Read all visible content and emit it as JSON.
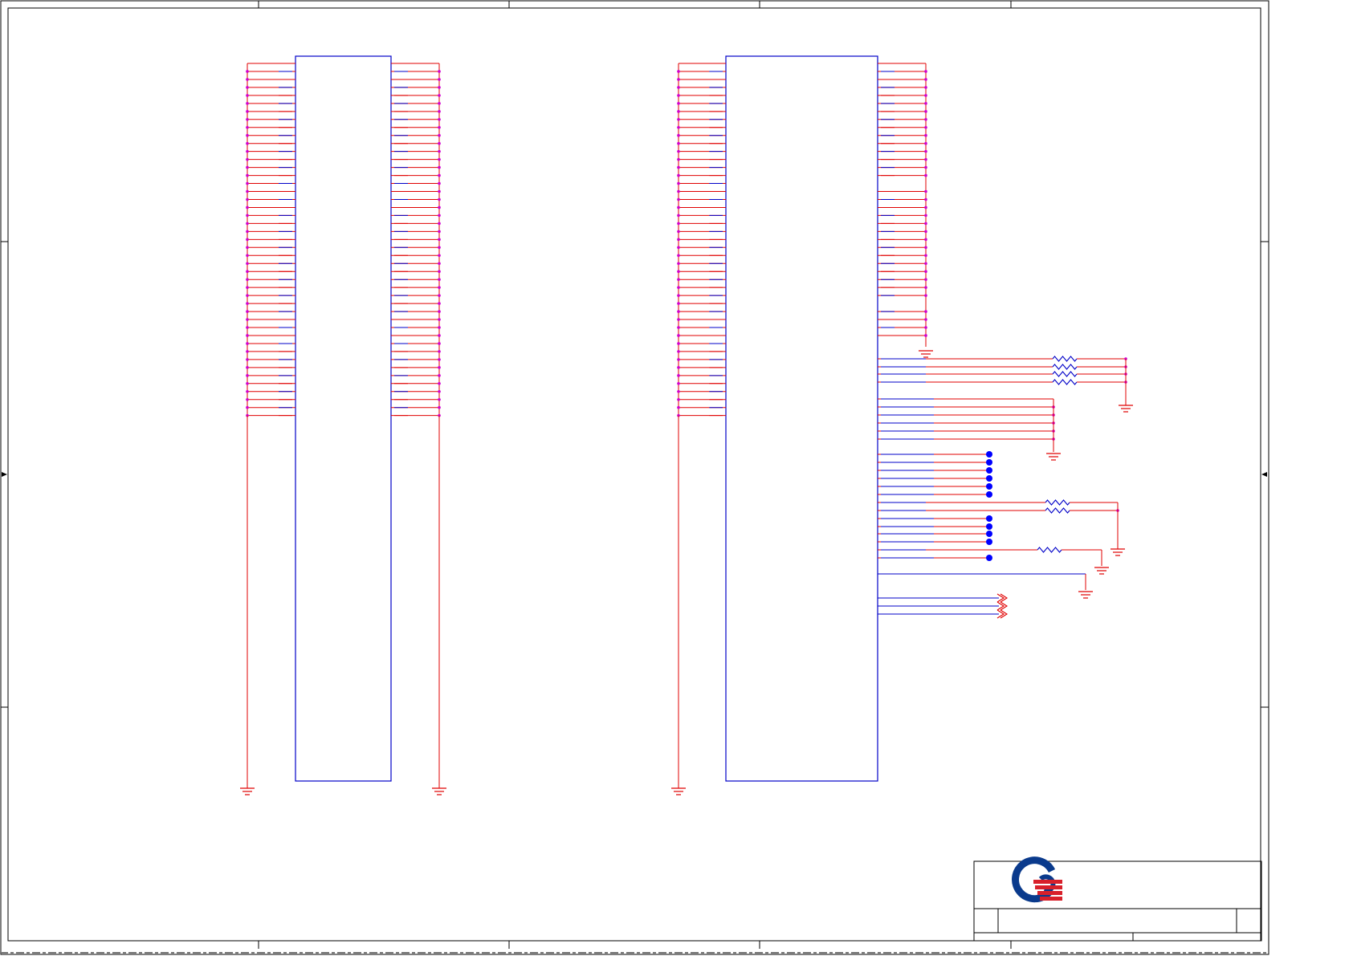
{
  "colors": {
    "border": "#000000",
    "wire": "#e00000",
    "net_wire": "#0000c8",
    "pin_dot": "#d000d0",
    "component_outline": "#0000c8",
    "no_connect_dot": "#0000ff",
    "logo_blue": "#0a3a8c",
    "logo_red": "#d8202a"
  },
  "icons": {
    "ground": "ground-symbol-icon",
    "resistor": "resistor-icon",
    "no_connect": "no-connect-dot-icon",
    "logo": "company-logo-icon"
  },
  "connector_a": {
    "left_pins": 45,
    "right_pins": 45
  },
  "connector_b": {
    "left_pins": 45,
    "right_top_pins": 30
  },
  "title_block": {
    "logo_name": "company-logo"
  }
}
